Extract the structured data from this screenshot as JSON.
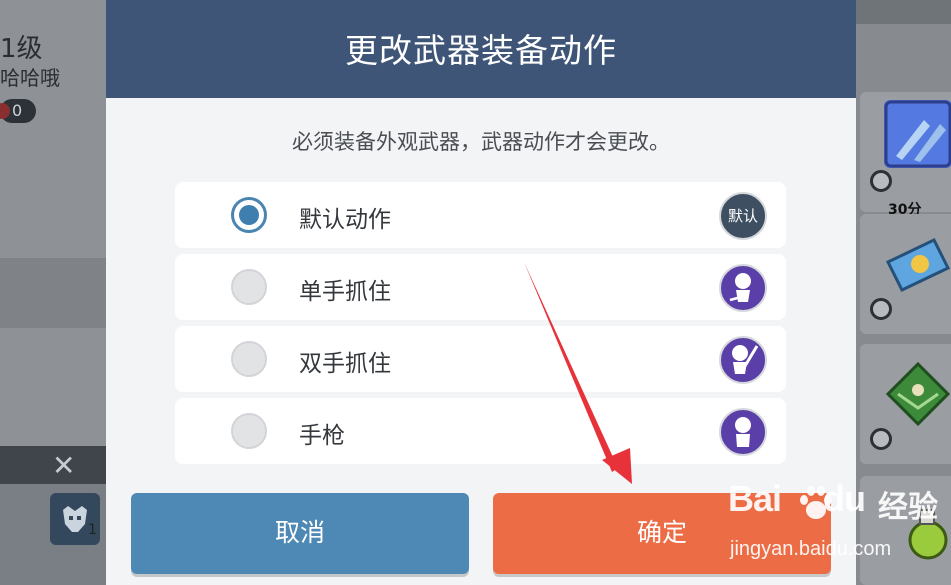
{
  "background": {
    "level_text": "1级",
    "name_text": "哈哈哦",
    "currency_value": "0",
    "close_glyph": "✕",
    "slot_count": "1",
    "timer_badge": "30分"
  },
  "dialog": {
    "title": "更改武器装备动作",
    "note": "必须装备外观武器，武器动作才会更改。",
    "options": [
      {
        "label": "默认动作",
        "selected": true,
        "icon": "default-badge-icon",
        "icon_text": "默认"
      },
      {
        "label": "单手抓住",
        "selected": false,
        "icon": "one-hand-pose-icon"
      },
      {
        "label": "双手抓住",
        "selected": false,
        "icon": "two-hand-pose-icon"
      },
      {
        "label": "手枪",
        "selected": false,
        "icon": "pistol-pose-icon"
      }
    ],
    "buttons": {
      "cancel": "取消",
      "confirm": "确定"
    }
  },
  "annotation": {
    "arrow_color": "#e8323a"
  },
  "watermark": {
    "brand": "Bai",
    "brand_suffix": "du",
    "cn": "经验",
    "url": "jingyan.baidu.com"
  },
  "colors": {
    "header": "#3f5577",
    "cancel_button": "#4e88b4",
    "confirm_button": "#ec6d45",
    "radio_selected": "#3f7fb0",
    "pose_icon_bg": "#5b3fa8"
  }
}
